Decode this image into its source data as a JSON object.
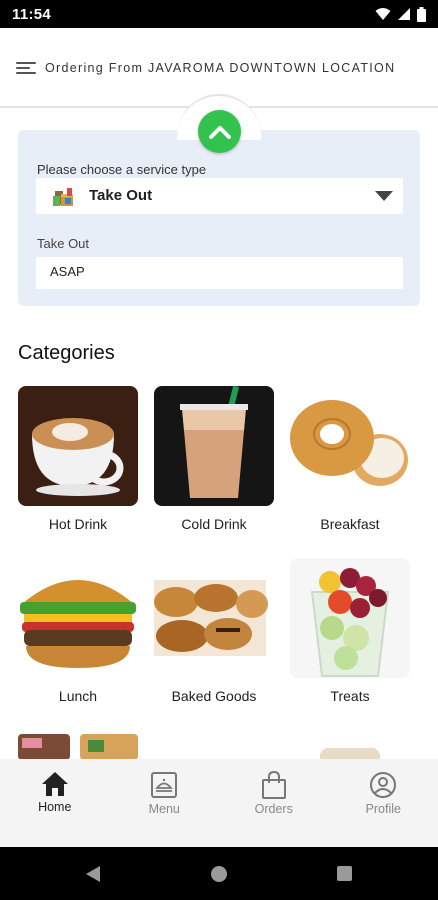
{
  "status_bar": {
    "time": "11:54"
  },
  "header": {
    "title": "Ordering From JAVAROMA DOWNTOWN LOCATION"
  },
  "service": {
    "label": "Please choose a service type",
    "selected": "Take Out",
    "time_label": "Take Out",
    "time_value": "ASAP"
  },
  "categories": {
    "title": "Categories",
    "items": [
      {
        "label": "Hot Drink"
      },
      {
        "label": "Cold Drink"
      },
      {
        "label": "Breakfast"
      },
      {
        "label": "Lunch"
      },
      {
        "label": "Baked Goods"
      },
      {
        "label": "Treats"
      }
    ]
  },
  "tabs": [
    {
      "label": "Home",
      "icon": "home-icon",
      "active": true
    },
    {
      "label": "Menu",
      "icon": "menu-box-icon",
      "active": false
    },
    {
      "label": "Orders",
      "icon": "shopping-bag-icon",
      "active": false
    },
    {
      "label": "Profile",
      "icon": "profile-icon",
      "active": false
    }
  ],
  "colors": {
    "accent_green": "#33c24d",
    "panel_bg": "#e8eef8",
    "tab_bar_bg": "#f4f4f4"
  }
}
